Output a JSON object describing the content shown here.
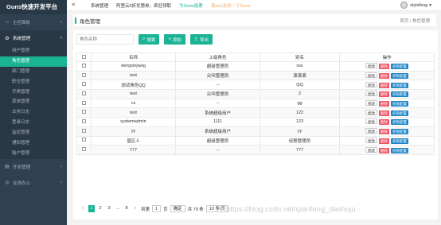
{
  "logo": "Guns快速开发平台",
  "sidebar": {
    "groups_top": [
      {
        "icon": "⌂",
        "label": "主控面板",
        "open": false
      },
      {
        "icon": "⚙",
        "label": "系统管理",
        "open": true
      }
    ],
    "subitems": [
      {
        "label": "用户管理",
        "active": false
      },
      {
        "label": "角色管理",
        "active": true
      },
      {
        "label": "部门管理",
        "active": false
      },
      {
        "label": "职位管理",
        "active": false
      },
      {
        "label": "字典管理",
        "active": false
      },
      {
        "label": "菜单管理",
        "active": false
      },
      {
        "label": "业务日志",
        "active": false
      },
      {
        "label": "登录日志",
        "active": false
      },
      {
        "label": "监控管理",
        "active": false
      },
      {
        "label": "通知管理",
        "active": false
      },
      {
        "label": "租户管理",
        "active": false
      }
    ],
    "groups_bottom": [
      {
        "icon": "▤",
        "label": "开发管理"
      },
      {
        "icon": "◎",
        "label": "在线办公"
      }
    ]
  },
  "topbar": {
    "nav": [
      "系统管理",
      "阿里云5折优惠券，疯狂领取",
      "为Guns投票",
      "请star支持一下Guns"
    ],
    "user": "stylefeng"
  },
  "page": {
    "title": "角色管理",
    "breadcrumb": "首页 / 角色管理"
  },
  "toolbar": {
    "search_placeholder": "角色名称",
    "search_label": "搜索",
    "add_label": "添加",
    "export_label": "导出"
  },
  "table": {
    "headers": [
      "",
      "名称",
      "上级角色",
      "别名",
      "操作"
    ],
    "actions": {
      "edit": "修改",
      "delete": "删除",
      "perm": "权限配置"
    },
    "rows": [
      [
        "dengxinjiang",
        "超级管理员",
        "sss"
      ],
      [
        "test",
        "尖叫管理员",
        "滚滚滚"
      ],
      [
        "测试角色QQ",
        "--",
        "QQ"
      ],
      [
        "test",
        "尖叫管理员",
        "2"
      ],
      [
        "cs",
        "--",
        "gg"
      ],
      [
        "test",
        "系统超级用户",
        "122"
      ],
      [
        "systemadmin",
        "1111",
        "123"
      ],
      [
        "yy",
        "系统超级用户",
        "yy"
      ],
      [
        "普区人",
        "超级管理员",
        "经联管理员"
      ],
      [
        "777",
        "--",
        "777"
      ]
    ]
  },
  "pager": {
    "prev": "‹",
    "pages": [
      "1",
      "2",
      "3",
      "...",
      "8"
    ],
    "next": "›",
    "goto_label": "到第",
    "goto_value": "1",
    "page_unit": "页",
    "confirm": "确定",
    "total": "共 79 条",
    "per_page": "10 条/页"
  },
  "watermark": "https://blog.csdn.net/qianfeng_dashuju"
}
